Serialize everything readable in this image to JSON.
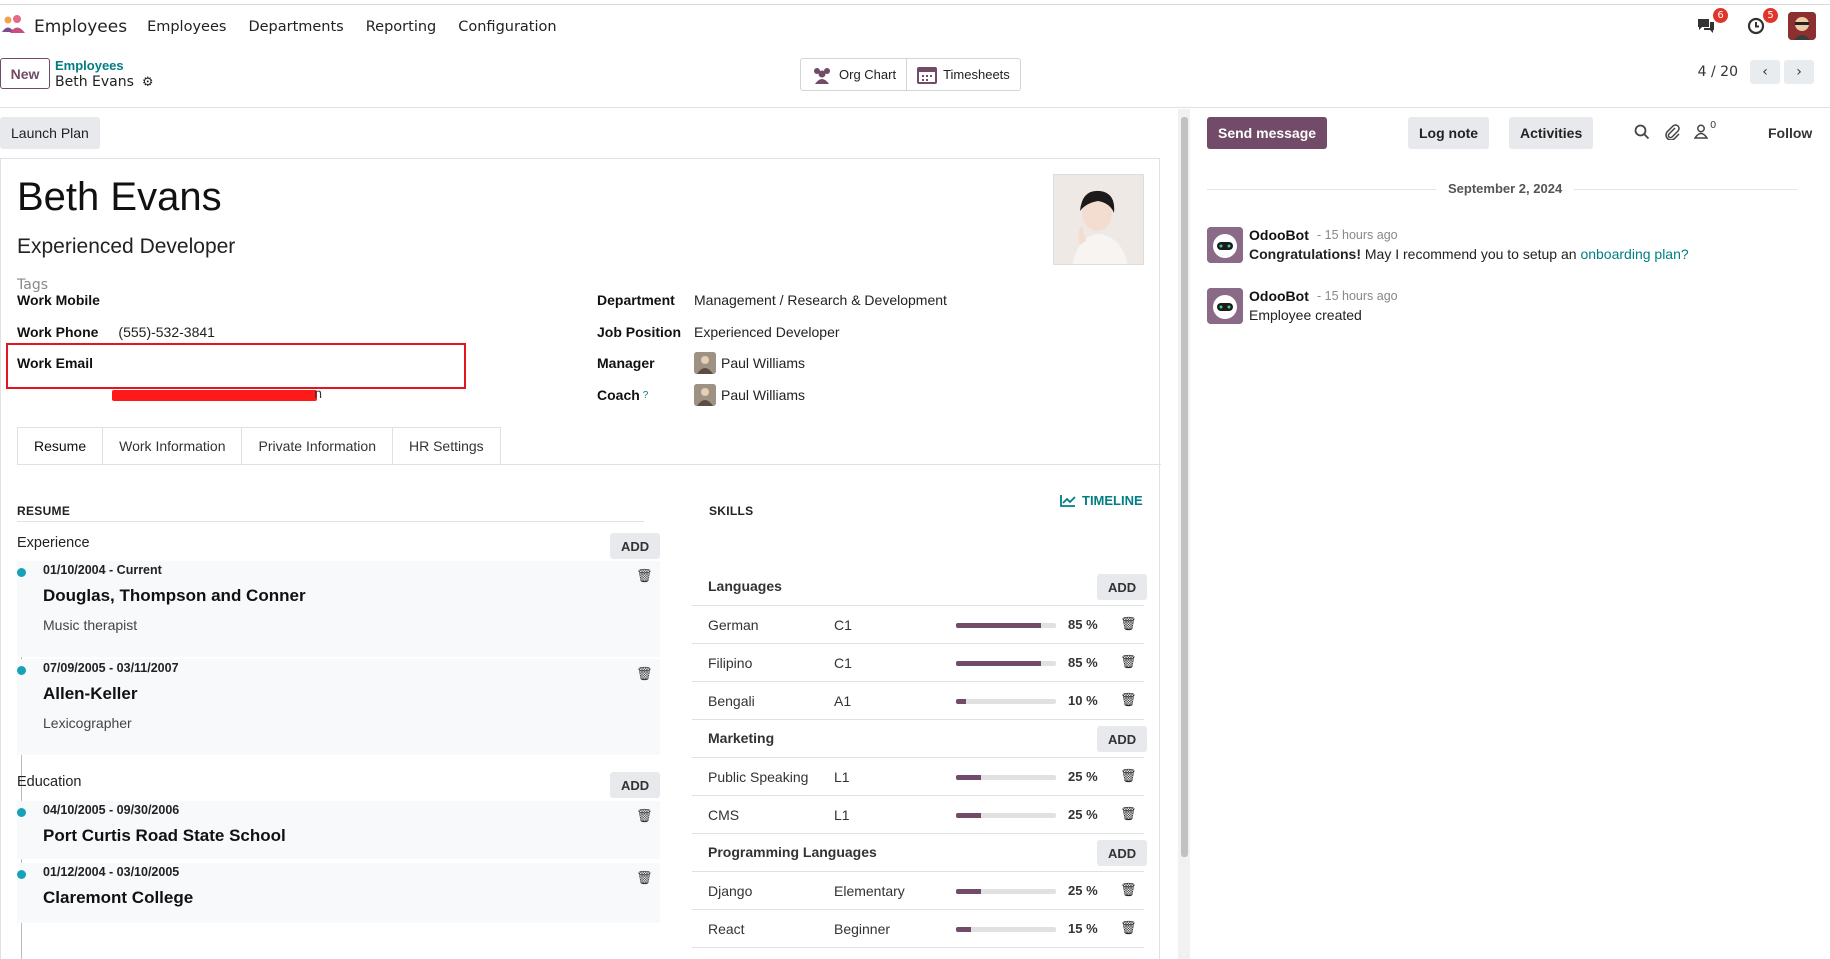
{
  "navbar": {
    "app_name": "Employees",
    "menu": [
      "Employees",
      "Departments",
      "Reporting",
      "Configuration"
    ],
    "messages_badge": "6",
    "activities_badge": "5"
  },
  "control_panel": {
    "new_label": "New",
    "breadcrumb_parent": "Employees",
    "breadcrumb_current": "Beth Evans",
    "smart_buttons": [
      "Org Chart",
      "Timesheets"
    ],
    "pager": "4 / 20"
  },
  "form": {
    "launch_plan_label": "Launch Plan",
    "name": "Beth Evans",
    "job_title": "Experienced Developer",
    "tags_placeholder": "Tags",
    "work_mobile_label": "Work Mobile",
    "work_mobile_value": "",
    "work_phone_label": "Work Phone",
    "work_phone_value": "(555)-532-3841",
    "work_email_label": "Work Email",
    "work_email_tail": "n",
    "department_label": "Department",
    "department_value": "Management / Research & Development",
    "job_position_label": "Job Position",
    "job_position_value": "Experienced Developer",
    "manager_label": "Manager",
    "manager_value": "Paul Williams",
    "coach_label": "Coach",
    "coach_help": "?",
    "coach_value": "Paul Williams"
  },
  "tabs": [
    "Resume",
    "Work Information",
    "Private Information",
    "HR Settings"
  ],
  "resume": {
    "title": "RESUME",
    "add_label": "ADD",
    "experience_label": "Experience",
    "education_label": "Education",
    "experience": [
      {
        "dates": "01/10/2004 - Current",
        "name": "Douglas, Thompson and Conner",
        "desc": "Music therapist"
      },
      {
        "dates": "07/09/2005 - 03/11/2007",
        "name": "Allen-Keller",
        "desc": "Lexicographer"
      }
    ],
    "education": [
      {
        "dates": "04/10/2005 - 09/30/2006",
        "name": "Port Curtis Road State School"
      },
      {
        "dates": "01/12/2004 - 03/10/2005",
        "name": "Claremont College"
      }
    ]
  },
  "skills": {
    "title": "SKILLS",
    "timeline_label": "TIMELINE",
    "add_label": "ADD",
    "groups": [
      {
        "name": "Languages",
        "items": [
          {
            "skill": "German",
            "level": "C1",
            "progress": 85,
            "pct": "85 %"
          },
          {
            "skill": "Filipino",
            "level": "C1",
            "progress": 85,
            "pct": "85 %"
          },
          {
            "skill": "Bengali",
            "level": "A1",
            "progress": 10,
            "pct": "10 %"
          }
        ]
      },
      {
        "name": "Marketing",
        "items": [
          {
            "skill": "Public Speaking",
            "level": "L1",
            "progress": 25,
            "pct": "25 %"
          },
          {
            "skill": "CMS",
            "level": "L1",
            "progress": 25,
            "pct": "25 %"
          }
        ]
      },
      {
        "name": "Programming Languages",
        "items": [
          {
            "skill": "Django",
            "level": "Elementary",
            "progress": 25,
            "pct": "25 %"
          },
          {
            "skill": "React",
            "level": "Beginner",
            "progress": 15,
            "pct": "15 %"
          }
        ]
      }
    ]
  },
  "chatter": {
    "send_message": "Send message",
    "log_note": "Log note",
    "activities": "Activities",
    "follower_count": "0",
    "follow": "Follow",
    "date": "September 2, 2024",
    "messages": [
      {
        "author": "OdooBot",
        "time": "- 15 hours ago",
        "bold": "Congratulations!",
        "text": " May I recommend you to setup an ",
        "link": "onboarding plan?"
      },
      {
        "author": "OdooBot",
        "time": "- 15 hours ago",
        "bold": "",
        "text": "Employee created",
        "link": ""
      }
    ]
  },
  "colors": {
    "brand": "#714b67",
    "link": "#017e84",
    "badge": "#e0352b",
    "timeline_dot": "#17a2b8",
    "highlight": "#e4151f"
  }
}
